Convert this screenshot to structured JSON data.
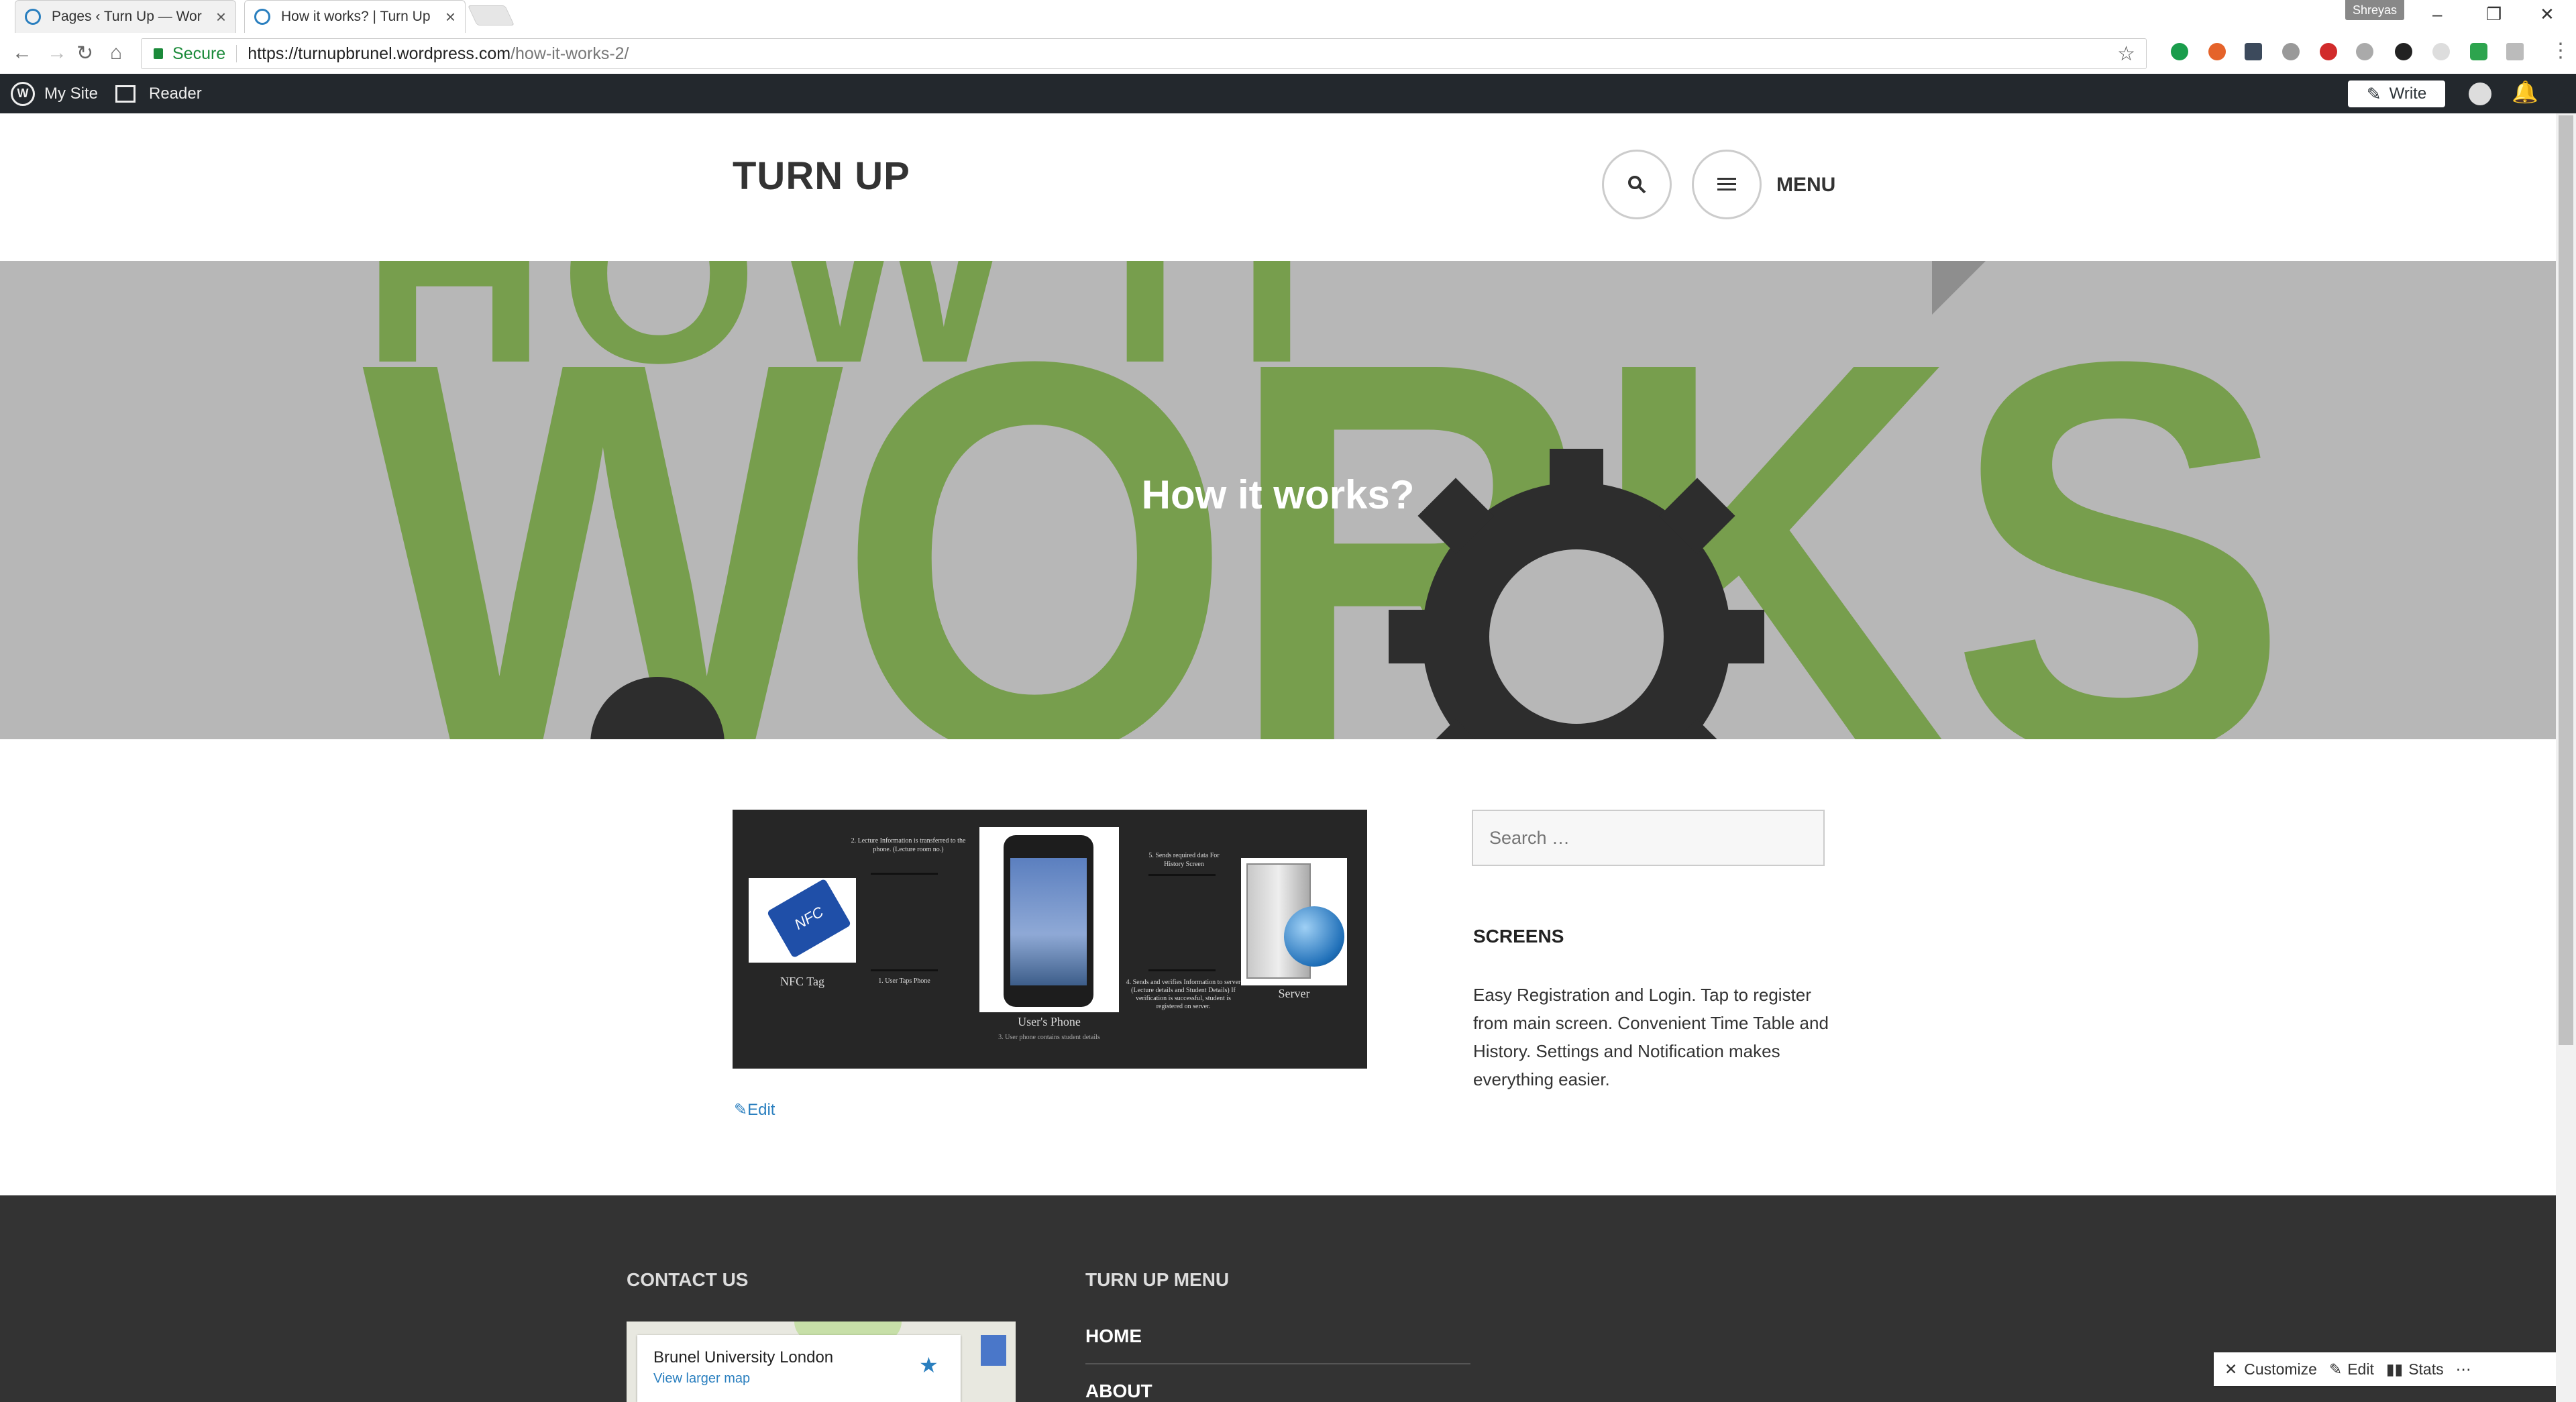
{
  "browser": {
    "tabs": [
      {
        "title": "Pages ‹ Turn Up — Wor",
        "active": false
      },
      {
        "title": "How it works? | Turn Up",
        "active": true
      }
    ],
    "profile_name": "Shreyas",
    "address": {
      "secure_label": "Secure",
      "host": "https://turnupbrunel.wordpress.com",
      "path": "/how-it-works-2/"
    }
  },
  "wp_admin_bar": {
    "my_site": "My Site",
    "reader": "Reader",
    "write": "Write"
  },
  "site": {
    "title": "TURN UP",
    "menu_label": "MENU"
  },
  "hero": {
    "title": "How it works?",
    "background_text_top": "HOW IT",
    "background_text_main": "WORKS"
  },
  "diagram": {
    "nfc_tag": "NFC Tag",
    "nfc_badge": "NFC",
    "step1": "1. User Taps Phone",
    "step2": "2. Lecture Information is transferred to the phone. (Lecture room no.)",
    "phone_label": "User's Phone",
    "step3": "3. User phone contains student details",
    "step4": "4. Sends and verifies Information to server (Lecture details and Student Details) If verification is successful, student is registered on server.",
    "step5": "5. Sends required data For History Screen",
    "server_label": "Server"
  },
  "content": {
    "edit_link": "Edit"
  },
  "sidebar": {
    "search_placeholder": "Search …",
    "widget_title": "SCREENS",
    "widget_text": "Easy Registration and Login. Tap to register from main screen. Convenient Time Table and History. Settings and Notification makes everything easier."
  },
  "footer": {
    "contact_title": "CONTACT US",
    "map_place": "Brunel University London",
    "map_link": "View larger map",
    "menu_title": "TURN UP MENU",
    "menu_items": [
      "HOME",
      "ABOUT"
    ]
  },
  "customizer_bar": {
    "customize": "Customize",
    "edit": "Edit",
    "stats": "Stats"
  },
  "colors": {
    "admin_bar": "#23282d",
    "footer": "#333333",
    "link": "#2a7fbf",
    "hero_green": "#6c9a3b"
  }
}
